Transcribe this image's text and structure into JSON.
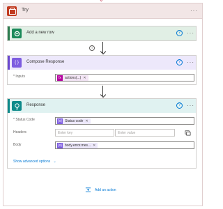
{
  "scope": {
    "title": "Try",
    "menu": "···"
  },
  "add_row": {
    "title": "Add a new row",
    "help": "?",
    "menu": "···"
  },
  "connector_info": "i",
  "compose": {
    "title": "Compose Response",
    "help": "?",
    "menu": "···",
    "inputs_label": "* Inputs",
    "token_text": "actions(...)",
    "token_icon": "fx"
  },
  "response": {
    "title": "Response",
    "help": "?",
    "menu": "···",
    "status_label": "* Status Code",
    "status_token": "Status code",
    "headers_label": "Headers",
    "key_placeholder": "Enter key",
    "value_placeholder": "Enter value",
    "body_label": "Body",
    "body_token": "body.error.mes...",
    "advanced": "Show advanced options"
  },
  "add_action": "Add an action",
  "colors": {
    "scope_accent": "#c13b20",
    "dataverse_green": "#1b8a5a",
    "compose_purple": "#7d5ce0",
    "response_teal": "#0e8a8a",
    "link_blue": "#0078d4"
  }
}
